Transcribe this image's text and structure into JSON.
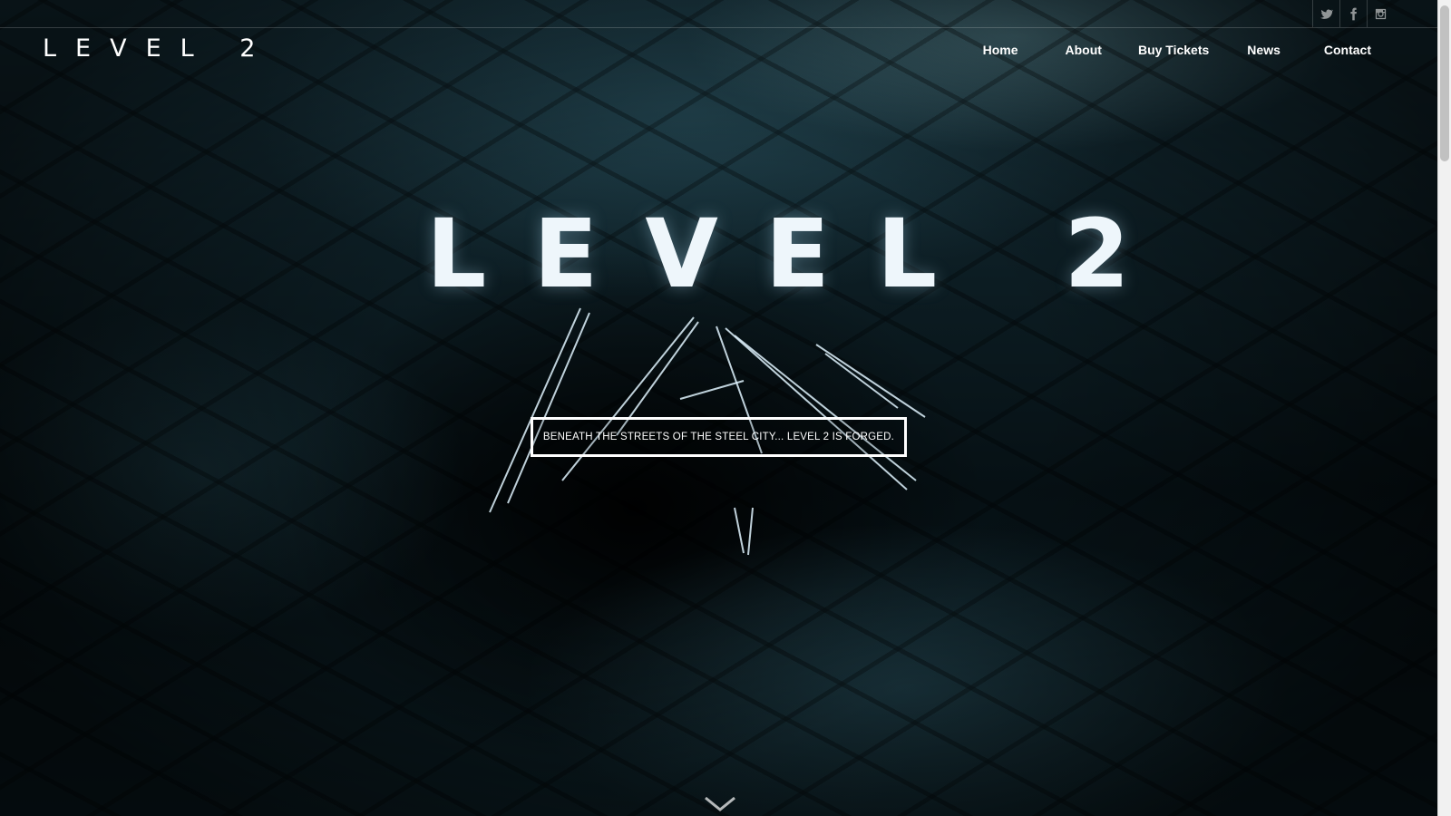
{
  "social": {
    "twitter": "twitter-icon",
    "facebook": "facebook-icon",
    "instagram": "instagram-icon"
  },
  "header": {
    "logo": "LEVEL 2",
    "nav": {
      "home": "Home",
      "about": "About",
      "buy_tickets": "Buy Tickets",
      "news": "News",
      "contact": "Contact"
    }
  },
  "hero": {
    "title": "LEVEL 2",
    "tagline": "BENEATH THE STREETS OF THE STEEL CITY... LEVEL 2 IS FORGED.",
    "scroll_icon": "chevron-down-icon"
  },
  "colors": {
    "text": "#ffffff",
    "accent_glow": "#eef6fb",
    "background": "#061014"
  }
}
